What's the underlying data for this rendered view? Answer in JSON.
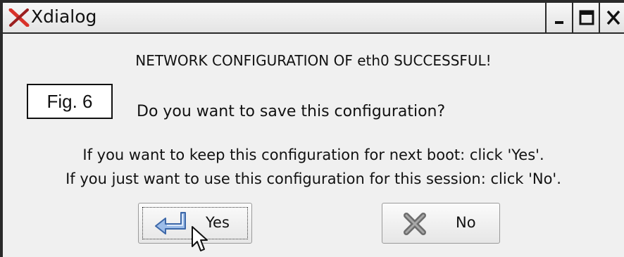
{
  "window": {
    "title": "Xdialog",
    "icon": "x-logo-icon",
    "controls": [
      "minimize-icon",
      "maximize-icon",
      "close-icon"
    ]
  },
  "dialog": {
    "heading": "NETWORK CONFIGURATION OF eth0 SUCCESSFUL!",
    "figure_label": "Fig. 6",
    "question": "Do you want to save this configuration?",
    "info_line_1": "If you want to keep this configuration for next boot: click 'Yes'.",
    "info_line_2": "If you just want to use this configuration for this session: click 'No'."
  },
  "buttons": {
    "yes": {
      "label": "Yes",
      "icon": "enter-arrow-icon",
      "focused": true
    },
    "no": {
      "label": "No",
      "icon": "x-cross-icon"
    }
  },
  "colors": {
    "window_bg": "#f0f0f0",
    "frame": "#2a2a2a",
    "logo_red": "#d8322a",
    "arrow_blue": "#4f7fc6"
  }
}
